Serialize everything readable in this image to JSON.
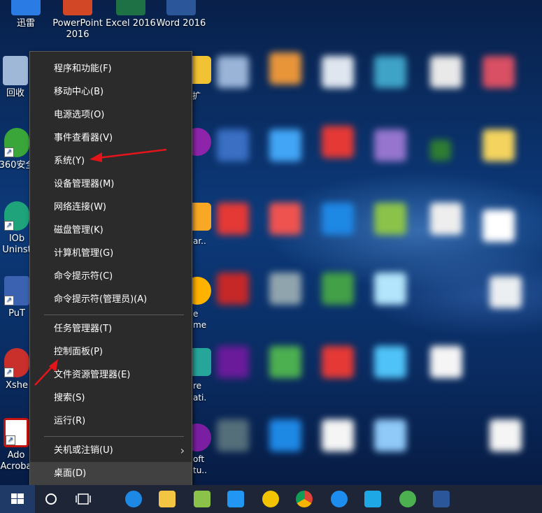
{
  "desktop": {
    "top_icons": [
      {
        "label": "迅雷",
        "icon": "xunlei-icon",
        "color": "#2a7be4"
      },
      {
        "label": "PowerPoint 2016",
        "icon": "powerpoint-icon",
        "color": "#d24726"
      },
      {
        "label": "Excel 2016",
        "icon": "excel-icon",
        "color": "#1e7145"
      },
      {
        "label": "Word 2016",
        "icon": "word-icon",
        "color": "#2b579a"
      }
    ],
    "left_icons": [
      {
        "label": "回收",
        "icon": "recycle-bin-icon",
        "color": "#9fb8d8"
      },
      {
        "label": "360安全",
        "icon": "360-security-icon",
        "color": "#3aa63a"
      },
      {
        "label": "IOb",
        "label2": "Uninst",
        "icon": "iobit-uninstaller-icon",
        "color": "#1fa37a"
      },
      {
        "label": "PuT",
        "icon": "putty-icon",
        "color": "#3b62b0"
      },
      {
        "label": "Xshe",
        "icon": "xshell-icon",
        "color": "#c9302c"
      },
      {
        "label": "Ado",
        "label2": "Acroba",
        "icon": "adobe-acrobat-icon",
        "color": "#c4130f"
      }
    ],
    "edge_texts": [
      "扩",
      "ar..",
      "e",
      "me",
      "re",
      "ati.",
      "oft",
      "tu.."
    ]
  },
  "menu": {
    "group1": [
      {
        "label": "程序和功能(F)"
      },
      {
        "label": "移动中心(B)"
      },
      {
        "label": "电源选项(O)"
      },
      {
        "label": "事件查看器(V)"
      },
      {
        "label": "系统(Y)"
      },
      {
        "label": "设备管理器(M)"
      },
      {
        "label": "网络连接(W)"
      },
      {
        "label": "磁盘管理(K)"
      },
      {
        "label": "计算机管理(G)"
      },
      {
        "label": "命令提示符(C)"
      },
      {
        "label": "命令提示符(管理员)(A)"
      }
    ],
    "group2": [
      {
        "label": "任务管理器(T)"
      },
      {
        "label": "控制面板(P)"
      },
      {
        "label": "文件资源管理器(E)"
      },
      {
        "label": "搜索(S)"
      },
      {
        "label": "运行(R)"
      }
    ],
    "shutdown": {
      "label": "关机或注销(U)",
      "chevron": "›"
    },
    "desktop_item": {
      "label": "桌面(D)"
    }
  },
  "taskbar": {
    "items": [
      {
        "name": "cortana-icon",
        "color": "#ffffff"
      },
      {
        "name": "task-view-icon",
        "color": "#ffffff"
      },
      {
        "name": "edge-browser-icon",
        "color": "#1e88e5"
      },
      {
        "name": "file-explorer-icon",
        "color": "#f4c542"
      },
      {
        "name": "notepad-icon",
        "color": "#8bc34a"
      },
      {
        "name": "store-icon",
        "color": "#2196f3"
      },
      {
        "name": "360-browser-icon",
        "color": "#f2c300"
      },
      {
        "name": "chrome-icon",
        "color": "#db4437"
      },
      {
        "name": "kugou-icon",
        "color": "#1d8ef0"
      },
      {
        "name": "qq-icon",
        "color": "#1fa8e6"
      },
      {
        "name": "360-speed-icon",
        "color": "#4caf50"
      },
      {
        "name": "word-taskbar-icon",
        "color": "#2b579a"
      }
    ]
  },
  "colors": {
    "annotation_arrow": "#e3141a",
    "menu_bg": "#2b2b2b",
    "menu_highlight": "#414141"
  }
}
